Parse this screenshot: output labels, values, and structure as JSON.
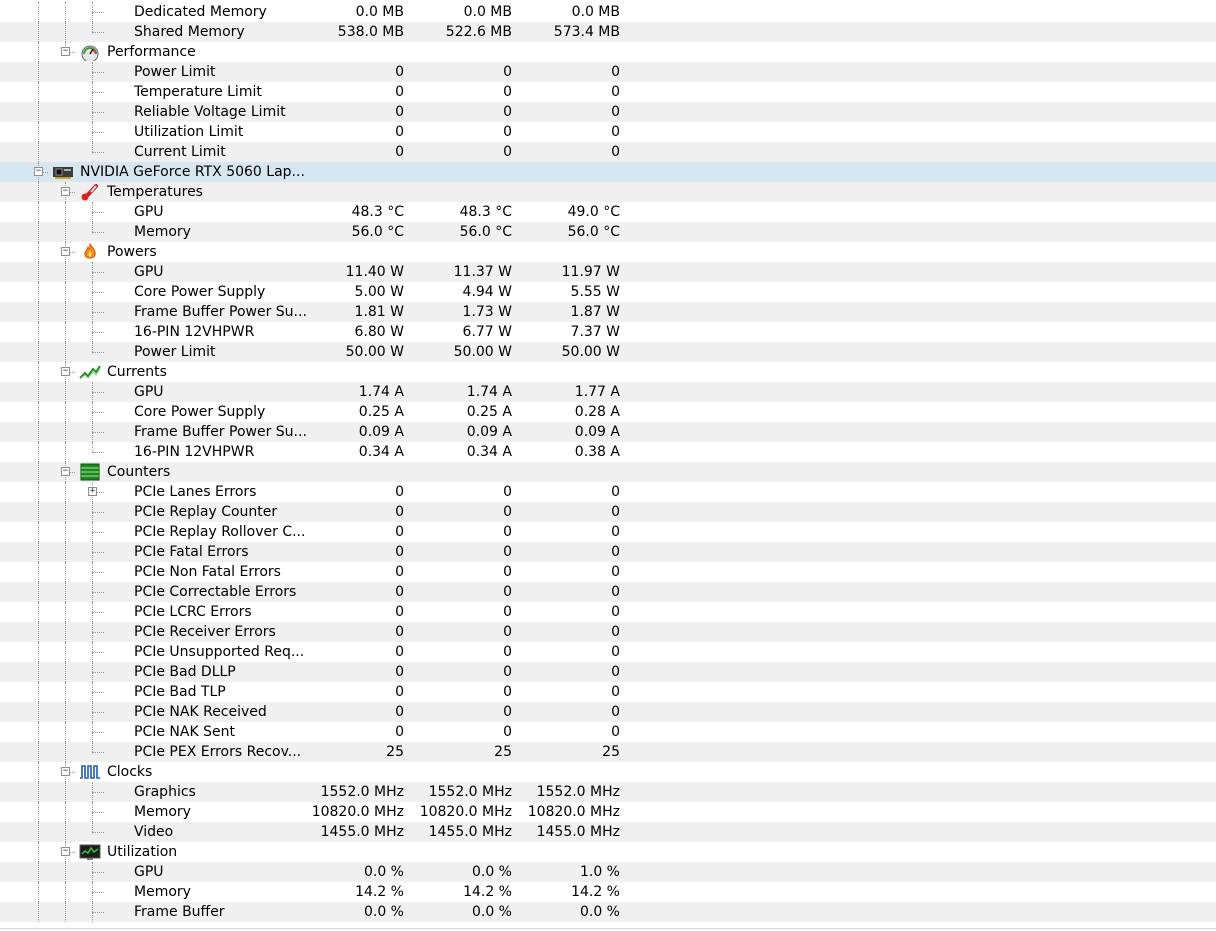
{
  "rows": [
    {
      "type": "sensor",
      "label": "Dedicated Memory",
      "v": [
        "0.0 MB",
        "0.0 MB",
        "0.0 MB"
      ],
      "cont": [
        1,
        1,
        0
      ]
    },
    {
      "type": "sensor",
      "label": "Shared Memory",
      "v": [
        "538.0 MB",
        "522.6 MB",
        "573.4 MB"
      ],
      "cont": [
        1,
        1,
        0
      ],
      "last": 1
    },
    {
      "type": "group",
      "label": "Performance",
      "icon": "gauge",
      "cont": [
        1,
        0,
        0
      ],
      "expanded": true,
      "last": 1
    },
    {
      "type": "sensor",
      "label": "Power Limit",
      "v": [
        "0",
        "0",
        "0"
      ],
      "cont": [
        1,
        0,
        0
      ]
    },
    {
      "type": "sensor",
      "label": "Temperature Limit",
      "v": [
        "0",
        "0",
        "0"
      ],
      "cont": [
        1,
        0,
        0
      ]
    },
    {
      "type": "sensor",
      "label": "Reliable Voltage Limit",
      "v": [
        "0",
        "0",
        "0"
      ],
      "cont": [
        1,
        0,
        0
      ]
    },
    {
      "type": "sensor",
      "label": "Utilization Limit",
      "v": [
        "0",
        "0",
        "0"
      ],
      "cont": [
        1,
        0,
        0
      ]
    },
    {
      "type": "sensor",
      "label": "Current Limit",
      "v": [
        "0",
        "0",
        "0"
      ],
      "cont": [
        1,
        0,
        0
      ],
      "last": 1
    },
    {
      "type": "device",
      "label": "NVIDIA GeForce RTX 5060 Lap...",
      "icon": "gpu-card",
      "cont": [
        1,
        0,
        0
      ],
      "expanded": true,
      "selected": true
    },
    {
      "type": "group",
      "label": "Temperatures",
      "icon": "thermometer",
      "cont": [
        1,
        1,
        0
      ],
      "expanded": true
    },
    {
      "type": "sensor",
      "label": "GPU",
      "v": [
        "48.3 °C",
        "48.3 °C",
        "49.0 °C"
      ],
      "cont": [
        1,
        1,
        0
      ]
    },
    {
      "type": "sensor",
      "label": "Memory",
      "v": [
        "56.0 °C",
        "56.0 °C",
        "56.0 °C"
      ],
      "cont": [
        1,
        1,
        0
      ],
      "last": 1
    },
    {
      "type": "group",
      "label": "Powers",
      "icon": "flame",
      "cont": [
        1,
        1,
        0
      ],
      "expanded": true
    },
    {
      "type": "sensor",
      "label": "GPU",
      "v": [
        "11.40 W",
        "11.37 W",
        "11.97 W"
      ],
      "cont": [
        1,
        1,
        0
      ]
    },
    {
      "type": "sensor",
      "label": "Core Power Supply",
      "v": [
        "5.00 W",
        "4.94 W",
        "5.55 W"
      ],
      "cont": [
        1,
        1,
        0
      ]
    },
    {
      "type": "sensor",
      "label": "Frame Buffer Power Su...",
      "v": [
        "1.81 W",
        "1.73 W",
        "1.87 W"
      ],
      "cont": [
        1,
        1,
        0
      ]
    },
    {
      "type": "sensor",
      "label": "16-PIN 12VHPWR",
      "v": [
        "6.80 W",
        "6.77 W",
        "7.37 W"
      ],
      "cont": [
        1,
        1,
        0
      ]
    },
    {
      "type": "sensor",
      "label": "Power Limit",
      "v": [
        "50.00 W",
        "50.00 W",
        "50.00 W"
      ],
      "cont": [
        1,
        1,
        0
      ],
      "last": 1
    },
    {
      "type": "group",
      "label": "Currents",
      "icon": "current-graph",
      "cont": [
        1,
        1,
        0
      ],
      "expanded": true
    },
    {
      "type": "sensor",
      "label": "GPU",
      "v": [
        "1.74 A",
        "1.74 A",
        "1.77 A"
      ],
      "cont": [
        1,
        1,
        0
      ]
    },
    {
      "type": "sensor",
      "label": "Core Power Supply",
      "v": [
        "0.25 A",
        "0.25 A",
        "0.28 A"
      ],
      "cont": [
        1,
        1,
        0
      ]
    },
    {
      "type": "sensor",
      "label": "Frame Buffer Power Su...",
      "v": [
        "0.09 A",
        "0.09 A",
        "0.09 A"
      ],
      "cont": [
        1,
        1,
        0
      ]
    },
    {
      "type": "sensor",
      "label": "16-PIN 12VHPWR",
      "v": [
        "0.34 A",
        "0.34 A",
        "0.38 A"
      ],
      "cont": [
        1,
        1,
        0
      ],
      "last": 1
    },
    {
      "type": "group",
      "label": "Counters",
      "icon": "counter",
      "cont": [
        1,
        1,
        0
      ],
      "expanded": true
    },
    {
      "type": "sensor",
      "label": "PCIe Lanes Errors",
      "v": [
        "0",
        "0",
        "0"
      ],
      "cont": [
        1,
        1,
        0
      ],
      "collapsed": true
    },
    {
      "type": "sensor",
      "label": "PCIe Replay Counter",
      "v": [
        "0",
        "0",
        "0"
      ],
      "cont": [
        1,
        1,
        0
      ]
    },
    {
      "type": "sensor",
      "label": "PCIe Replay Rollover C...",
      "v": [
        "0",
        "0",
        "0"
      ],
      "cont": [
        1,
        1,
        0
      ]
    },
    {
      "type": "sensor",
      "label": "PCIe Fatal Errors",
      "v": [
        "0",
        "0",
        "0"
      ],
      "cont": [
        1,
        1,
        0
      ]
    },
    {
      "type": "sensor",
      "label": "PCIe Non Fatal Errors",
      "v": [
        "0",
        "0",
        "0"
      ],
      "cont": [
        1,
        1,
        0
      ]
    },
    {
      "type": "sensor",
      "label": "PCIe Correctable Errors",
      "v": [
        "0",
        "0",
        "0"
      ],
      "cont": [
        1,
        1,
        0
      ]
    },
    {
      "type": "sensor",
      "label": "PCIe LCRC Errors",
      "v": [
        "0",
        "0",
        "0"
      ],
      "cont": [
        1,
        1,
        0
      ]
    },
    {
      "type": "sensor",
      "label": "PCIe Receiver Errors",
      "v": [
        "0",
        "0",
        "0"
      ],
      "cont": [
        1,
        1,
        0
      ]
    },
    {
      "type": "sensor",
      "label": "PCIe Unsupported Req...",
      "v": [
        "0",
        "0",
        "0"
      ],
      "cont": [
        1,
        1,
        0
      ]
    },
    {
      "type": "sensor",
      "label": "PCIe Bad DLLP",
      "v": [
        "0",
        "0",
        "0"
      ],
      "cont": [
        1,
        1,
        0
      ]
    },
    {
      "type": "sensor",
      "label": "PCIe Bad TLP",
      "v": [
        "0",
        "0",
        "0"
      ],
      "cont": [
        1,
        1,
        0
      ]
    },
    {
      "type": "sensor",
      "label": "PCIe NAK Received",
      "v": [
        "0",
        "0",
        "0"
      ],
      "cont": [
        1,
        1,
        0
      ]
    },
    {
      "type": "sensor",
      "label": "PCIe NAK Sent",
      "v": [
        "0",
        "0",
        "0"
      ],
      "cont": [
        1,
        1,
        0
      ]
    },
    {
      "type": "sensor",
      "label": "PCIe PEX Errors Recov...",
      "v": [
        "25",
        "25",
        "25"
      ],
      "cont": [
        1,
        1,
        0
      ],
      "last": 1
    },
    {
      "type": "group",
      "label": "Clocks",
      "icon": "clock-wave",
      "cont": [
        1,
        1,
        0
      ],
      "expanded": true
    },
    {
      "type": "sensor",
      "label": "Graphics",
      "v": [
        "1552.0 MHz",
        "1552.0 MHz",
        "1552.0 MHz"
      ],
      "cont": [
        1,
        1,
        0
      ]
    },
    {
      "type": "sensor",
      "label": "Memory",
      "v": [
        "10820.0 MHz",
        "10820.0 MHz",
        "10820.0 MHz"
      ],
      "cont": [
        1,
        1,
        0
      ]
    },
    {
      "type": "sensor",
      "label": "Video",
      "v": [
        "1455.0 MHz",
        "1455.0 MHz",
        "1455.0 MHz"
      ],
      "cont": [
        1,
        1,
        0
      ],
      "last": 1
    },
    {
      "type": "group",
      "label": "Utilization",
      "icon": "monitor",
      "cont": [
        1,
        1,
        0
      ],
      "expanded": true
    },
    {
      "type": "sensor",
      "label": "GPU",
      "v": [
        "0.0 %",
        "0.0 %",
        "1.0 %"
      ],
      "cont": [
        1,
        1,
        0
      ]
    },
    {
      "type": "sensor",
      "label": "Memory",
      "v": [
        "14.2 %",
        "14.2 %",
        "14.2 %"
      ],
      "cont": [
        1,
        1,
        0
      ]
    },
    {
      "type": "sensor",
      "label": "Frame Buffer",
      "v": [
        "0.0 %",
        "0.0 %",
        "0.0 %"
      ],
      "cont": [
        1,
        1,
        0
      ]
    }
  ]
}
